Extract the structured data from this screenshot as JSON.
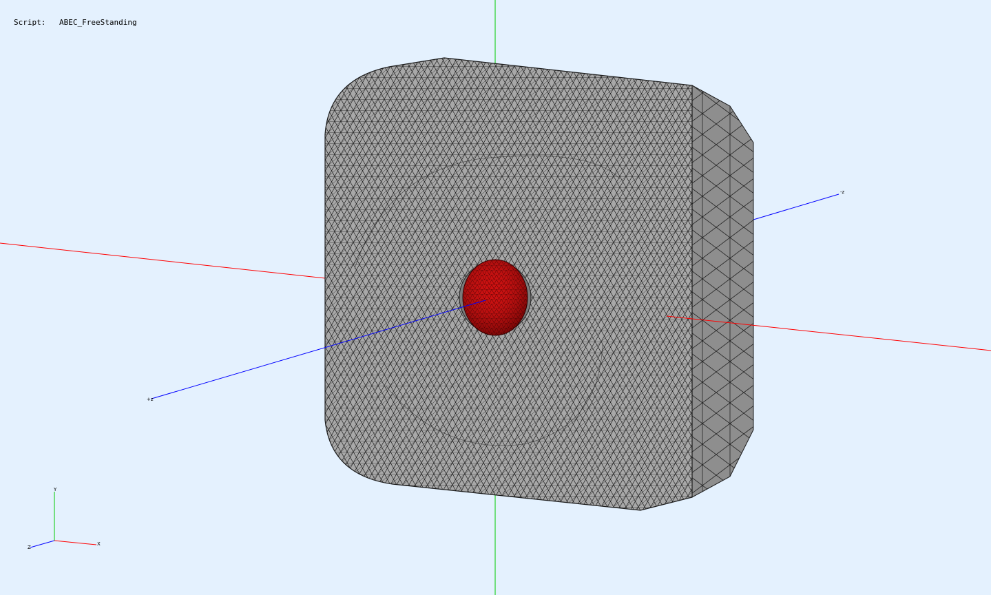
{
  "script": {
    "label": "Script:",
    "value": "ABEC_FreeStanding"
  },
  "scene": {
    "background": "#e4f1fe",
    "axes": {
      "x_color": "#ff0000",
      "y_color": "#00cc00",
      "z_color": "#0000ff",
      "z_plus_label": "+z",
      "z_minus_label": "-z"
    },
    "model": {
      "body_color": "#a8a8a8",
      "side_color": "#8e8e8e",
      "driver_color": "#cc1010"
    },
    "triad": {
      "x_label": "X",
      "y_label": "Y",
      "z_label": "Z"
    }
  }
}
